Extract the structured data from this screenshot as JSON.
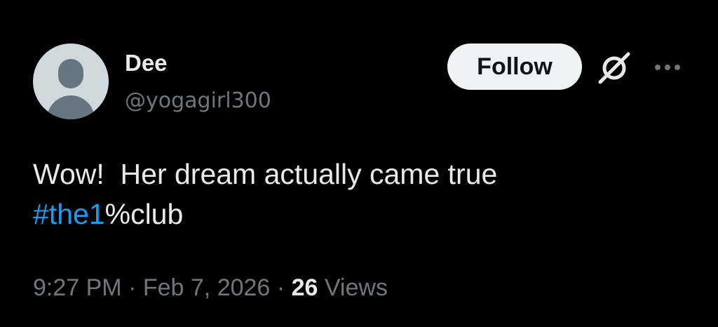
{
  "author": {
    "display_name": "Dee",
    "handle": "@yogagirl300",
    "avatar_icon": "default-person-avatar"
  },
  "header_actions": {
    "follow_label": "Follow",
    "grok_icon": "grok-icon",
    "more_icon": "more-horizontal-icon"
  },
  "tweet": {
    "line1": "Wow!  Her dream actually came true",
    "hashtag": "#the1",
    "hashtag_suffix": "%club"
  },
  "meta": {
    "time": "9:27 PM",
    "separator": "·",
    "date": "Feb 7, 2026",
    "views_count": "26",
    "views_label": "Views"
  },
  "colors": {
    "background": "#000000",
    "text_primary": "#e7e9ea",
    "text_secondary": "#71767b",
    "link": "#1d9bf0",
    "follow_bg": "#eff3f4"
  }
}
